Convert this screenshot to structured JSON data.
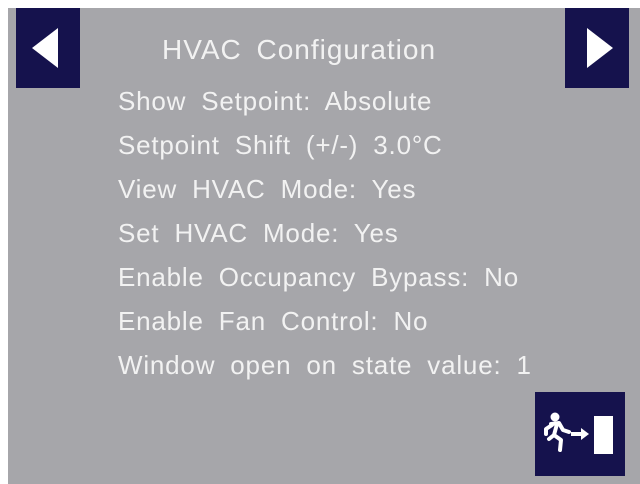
{
  "header": {
    "title": "HVAC Configuration",
    "prev_icon": "arrow-left-icon",
    "next_icon": "arrow-right-icon"
  },
  "settings": [
    {
      "label": "Show Setpoint: Absolute"
    },
    {
      "label": "Setpoint Shift (+/-) 3.0°C"
    },
    {
      "label": "View HVAC Mode: Yes"
    },
    {
      "label": "Set HVAC Mode: Yes"
    },
    {
      "label": "Enable Occupancy Bypass: No"
    },
    {
      "label": "Enable Fan Control: No"
    },
    {
      "label": "Window open on state value: 1"
    }
  ],
  "footer": {
    "exit_icon": "exit-door-icon"
  },
  "colors": {
    "background": "#a6a6aa",
    "button": "#15124d",
    "text": "#f2f2f2"
  }
}
